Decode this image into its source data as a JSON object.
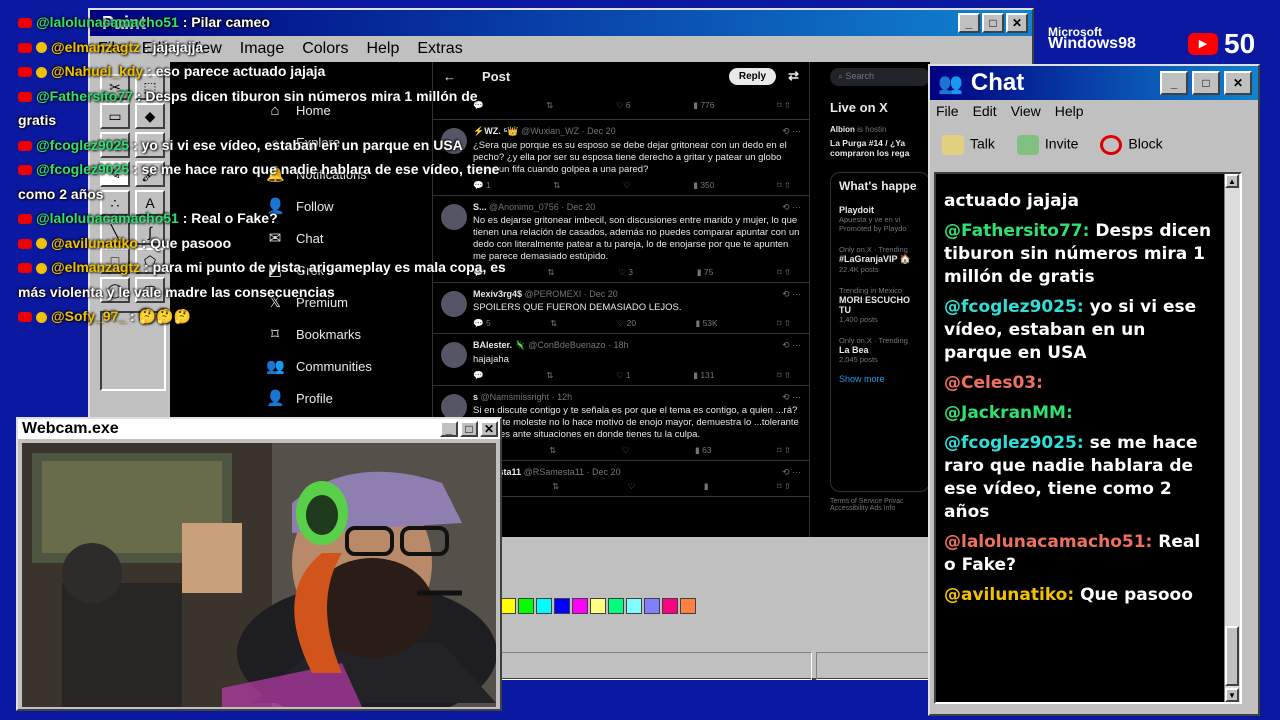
{
  "paint": {
    "title": "Paint",
    "menu": [
      "File",
      "Edit",
      "View",
      "Image",
      "Colors",
      "Help",
      "Extras"
    ],
    "palette": [
      "#ffff00",
      "#00ff00",
      "#00ffff",
      "#0000ff",
      "#ff00ff",
      "#ffff80",
      "#00ff80",
      "#80ffff",
      "#8080ff",
      "#ff0080",
      "#ff8040"
    ]
  },
  "brand": {
    "line1": "Microsoft",
    "line2": "Windows98"
  },
  "viewers": {
    "count": "50"
  },
  "twitter": {
    "header": "Post",
    "reply_button": "Reply",
    "search_placeholder": "Search",
    "nav": [
      {
        "label": "Home",
        "icon": "home-icon"
      },
      {
        "label": "Explore",
        "icon": "search-icon"
      },
      {
        "label": "Notifications",
        "icon": "bell-icon"
      },
      {
        "label": "Follow",
        "icon": "follow-icon"
      },
      {
        "label": "Chat",
        "icon": "chat-icon"
      },
      {
        "label": "Grok",
        "icon": "grok-icon"
      },
      {
        "label": "Premium",
        "icon": "x-icon"
      },
      {
        "label": "Bookmarks",
        "icon": "bookmark-icon"
      },
      {
        "label": "Communities",
        "icon": "communities-icon"
      },
      {
        "label": "Profile",
        "icon": "profile-icon"
      }
    ],
    "tweets": [
      {
        "name": "⚡WZ. ⁵👑",
        "handle": "@Wuxian_WZ · Dec 20",
        "text": "¿Sera que porque es su esposo se debe dejar gritonear con un dedo en el pecho? ¿y ella por ser su esposa tiene derecho a gritar y patear un globo como un fifa cuando golpea a una pared?",
        "replies": "1",
        "views": "350"
      },
      {
        "name": "S...",
        "handle": "@Anonimo_0756 · Dec 20",
        "text": "No es dejarse gritonear imbecil, son discusiones entre marido y mujer, lo que tienen una relación de casados, además no puedes comparar apuntar con un dedo con literalmente patear a tu pareja, lo de enojarse por que te apunten me parece demasiado estúpido.",
        "replies": "",
        "likes": "3",
        "views": "75"
      },
      {
        "name": "Mexiv3rg4$",
        "handle": "@PEROMEXI · Dec 20",
        "text": "SPOILERS QUE FUERON DEMASIADO LEJOS.",
        "replies": "5",
        "likes": "20",
        "views": "53K"
      },
      {
        "name": "BAlester. 🦎",
        "handle": "@ConBdeBuenazo · 18h",
        "text": "hajajaha",
        "replies": "",
        "likes": "1",
        "views": "131"
      },
      {
        "name": "s",
        "handle": "@Namsmissright · 12h",
        "text": "Si en discute contigo y te señala es por que el tema es contigo, a quien ...rá? El que te moleste no lo hace motivo de enojo mayor, demuestra lo ...tolerante que eres ante situaciones en donde tienes tu la culpa.",
        "replies": "",
        "likes": "",
        "views": "63"
      },
      {
        "name": "...amesta11",
        "handle": "@RSamesta11 · Dec 20",
        "text": "",
        "replies": "",
        "likes": "",
        "views": ""
      }
    ],
    "first_row_likes": "6",
    "first_row_views": "776",
    "sidebar": {
      "live_title": "Live on X",
      "live_user": "Albion",
      "live_suffix": "is hostin",
      "live_text": "La Purga #14 / ¿Ya compraron los rega",
      "happening_title": "What's happe",
      "trends": [
        {
          "meta": "",
          "name": "Playdoit",
          "sub": "Apuesta y ve en vi",
          "extra": "Promoted by Playdo"
        },
        {
          "meta": "Only on X · Trending",
          "name": "#LaGranjaVIP 🏠",
          "sub": "22.4K posts"
        },
        {
          "meta": "Trending in Mexico",
          "name": "MORI ESCUCHO TU",
          "sub": "1,400 posts"
        },
        {
          "meta": "Only on X · Trending",
          "name": "La Bea",
          "sub": "2,045 posts"
        }
      ],
      "show_more": "Show more",
      "footer": "Terms of Service  Privac  Accessibility  Ads Info"
    }
  },
  "overlay": [
    {
      "user": "@lalolunacamacho51",
      "text": " : Pilar cameo",
      "badge": false
    },
    {
      "user": "@elmanzagtz",
      "text": " : jajajajja",
      "badge": true
    },
    {
      "user": "@Nahuel_kdy",
      "text": " : eso parece actuado jajaja",
      "badge": true
    },
    {
      "user": "@Fathersito77",
      "text": " : Desps dicen tiburon sin números mira 1 millón de gratis",
      "badge": false
    },
    {
      "user": "@fcoglez9025",
      "text": " : yo si vi ese vídeo, estaban en un parque en USA",
      "badge": false
    },
    {
      "user": "@fcoglez9025",
      "text": " : se me hace raro que nadie hablara de ese vídeo, tiene como 2 años",
      "badge": false
    },
    {
      "user": "@lalolunacamacho51",
      "text": " : Real o Fake?",
      "badge": false
    },
    {
      "user": "@avilunatiko",
      "text": " : Que pasooo",
      "badge": true
    },
    {
      "user": "@elmanzagtz",
      "text": " : para mi punto de vista, arigameplay es mala copa, es más violenta y le vale madre las consecuencias",
      "badge": true
    },
    {
      "user": "@Sofy_97_",
      "text": " : 🤔🤔🤔",
      "badge": true
    }
  ],
  "chat": {
    "title": "Chat",
    "menu": [
      "File",
      "Edit",
      "View",
      "Help"
    ],
    "toolbar": [
      {
        "label": "Talk",
        "icon": "talk-icon"
      },
      {
        "label": "Invite",
        "icon": "invite-icon"
      },
      {
        "label": "Block",
        "icon": "block-icon"
      }
    ],
    "messages": [
      {
        "user": "",
        "text": "actuado jajaja",
        "color": ""
      },
      {
        "user": "@Fathersito77:",
        "text": " Desps dicen tiburon sin números mira 1 millón de gratis",
        "color": "g"
      },
      {
        "user": "@fcoglez9025:",
        "text": " yo si vi ese vídeo, estaban en un parque en USA",
        "color": ""
      },
      {
        "user": "@Celes03:",
        "text": "",
        "color": "r"
      },
      {
        "user": "@JackranMM:",
        "text": "",
        "color": "g"
      },
      {
        "user": "@fcoglez9025:",
        "text": " se me hace raro que nadie hablara de ese vídeo, tiene como 2 años",
        "color": ""
      },
      {
        "user": "@lalolunacamacho51:",
        "text": " Real o Fake?",
        "color": "r"
      },
      {
        "user": "@avilunatiko:",
        "text": " Que pasooo",
        "color": "y"
      }
    ]
  },
  "webcam": {
    "title": "Webcam.exe"
  }
}
